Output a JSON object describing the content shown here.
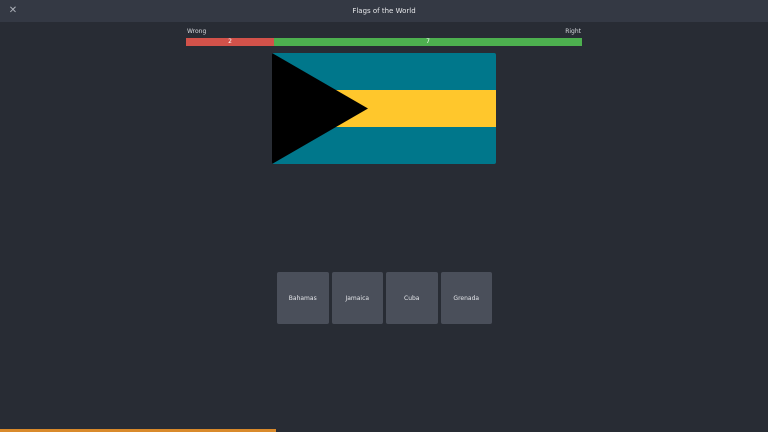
{
  "window": {
    "title": "Flags of the World",
    "close_icon": "close-icon",
    "close_glyph": "✕"
  },
  "score": {
    "wrong_label": "Wrong",
    "right_label": "Right",
    "wrong_count": "2",
    "right_count": "7",
    "wrong_color": "#d2524a",
    "right_color": "#4db04f"
  },
  "flag": {
    "stripe_colors": [
      "#00778b",
      "#ffc72c",
      "#00778b"
    ],
    "triangle_color": "#000000"
  },
  "choices": [
    {
      "label": "Bahamas"
    },
    {
      "label": "Jamaica"
    },
    {
      "label": "Cuba"
    },
    {
      "label": "Grenada"
    }
  ],
  "timer": {
    "progress": 0.36,
    "color": "#d98a2b"
  }
}
